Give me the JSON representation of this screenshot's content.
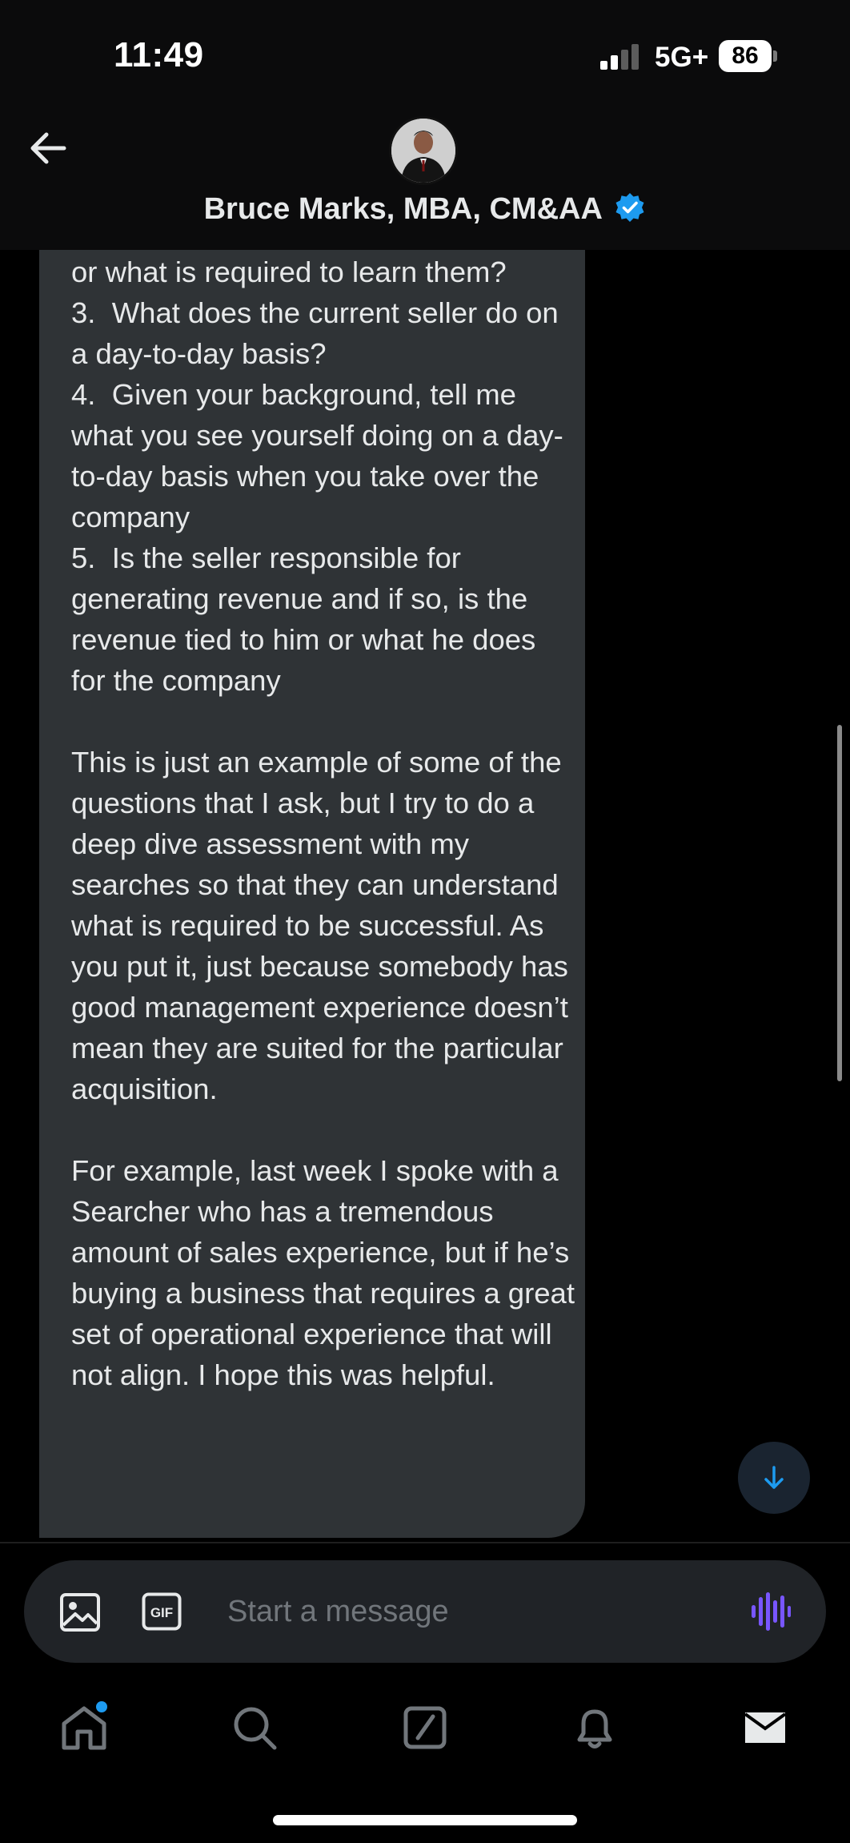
{
  "status_bar": {
    "time": "11:49",
    "network": "5G+",
    "battery_percent": "86"
  },
  "header": {
    "contact_name": "Bruce Marks, MBA, CM&AA",
    "verified": true
  },
  "message": {
    "text": "or what is required to learn them?\n3.  What does the current seller do on a day-to-day basis?\n4.  Given your background, tell me what you see yourself doing on a day-to-day basis when you take over the company\n5.  Is the seller responsible for generating revenue and if so, is the revenue tied to him or what he does for the company\n\nThis is just an example of some of the questions that I ask, but I try to do a deep dive assessment with my searches so that they can understand what is required to be successful. As you put it, just because somebody has good management experience doesn’t mean they are suited for the particular acquisition.\n\nFor example, last week I spoke with a Searcher who has a tremendous amount of sales experience, but if he’s buying a business that requires a great set of operational experience that will not align. I hope this was helpful."
  },
  "composer": {
    "placeholder": "Start a message",
    "gif_label": "GIF"
  },
  "colors": {
    "background": "#000000",
    "bubble": "#2f3336",
    "accent_blue": "#1d9bf0",
    "voice_purple": "#7856ff"
  },
  "icons": {
    "back": "arrow-left-icon",
    "verified": "verified-badge-icon",
    "scroll_down": "arrow-down-icon",
    "image": "image-icon",
    "gif": "gif-icon",
    "voice": "voice-wave-icon",
    "tabs": [
      "home-icon",
      "search-icon",
      "compose-icon",
      "bell-icon",
      "envelope-icon"
    ]
  },
  "tabs": {
    "home_has_notification": true
  }
}
